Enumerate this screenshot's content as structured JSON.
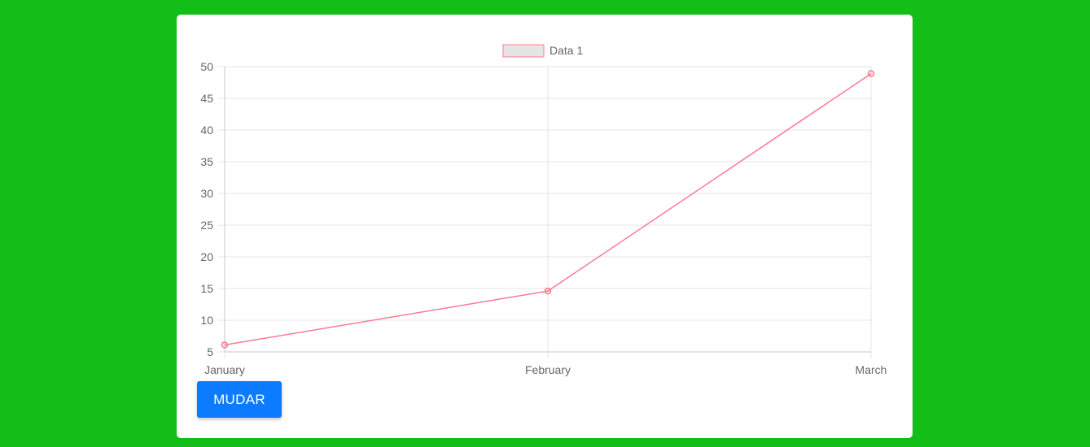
{
  "button": {
    "label": "MUDAR"
  },
  "colors": {
    "background": "#13be18",
    "series_line": "#ff7a93",
    "legend_fill": "#e5e5e5",
    "button": "#0d7bff"
  },
  "chart_data": {
    "type": "line",
    "categories": [
      "January",
      "February",
      "March"
    ],
    "series": [
      {
        "name": "Data 1",
        "values": [
          6.1,
          14.6,
          48.9
        ]
      }
    ],
    "title": "",
    "xlabel": "",
    "ylabel": "",
    "ylim": [
      5,
      50
    ],
    "yticks": [
      50,
      45,
      40,
      35,
      30,
      25,
      20,
      15,
      10,
      5
    ],
    "grid": true,
    "legend": "top-center"
  }
}
